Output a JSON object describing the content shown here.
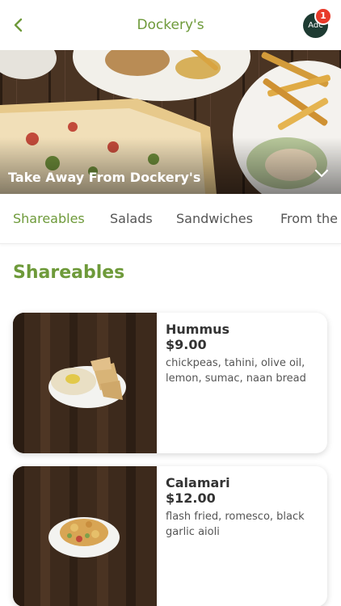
{
  "header": {
    "title": "Dockery's",
    "back_icon": "chevron-left-icon",
    "avatar_label": "Adc",
    "cart_badge_count": "1"
  },
  "hero": {
    "title": "Take Away From Dockery's",
    "expand_icon": "chevron-down-icon"
  },
  "tabs": [
    {
      "label": "Shareables",
      "active": true
    },
    {
      "label": "Salads",
      "active": false
    },
    {
      "label": "Sandwiches",
      "active": false
    },
    {
      "label": "From the",
      "active": false
    }
  ],
  "section": {
    "title": "Shareables"
  },
  "items": [
    {
      "name": "Hummus",
      "price": "$9.00",
      "description": "chickpeas, tahini, olive oil, lemon, sumac, naan bread"
    },
    {
      "name": "Calamari",
      "price": "$12.00",
      "description": "flash fried, romesco, black garlic aioli"
    }
  ],
  "colors": {
    "accent": "#6e9a3a",
    "badge": "#e83a2a",
    "avatar": "#1e3b32"
  }
}
